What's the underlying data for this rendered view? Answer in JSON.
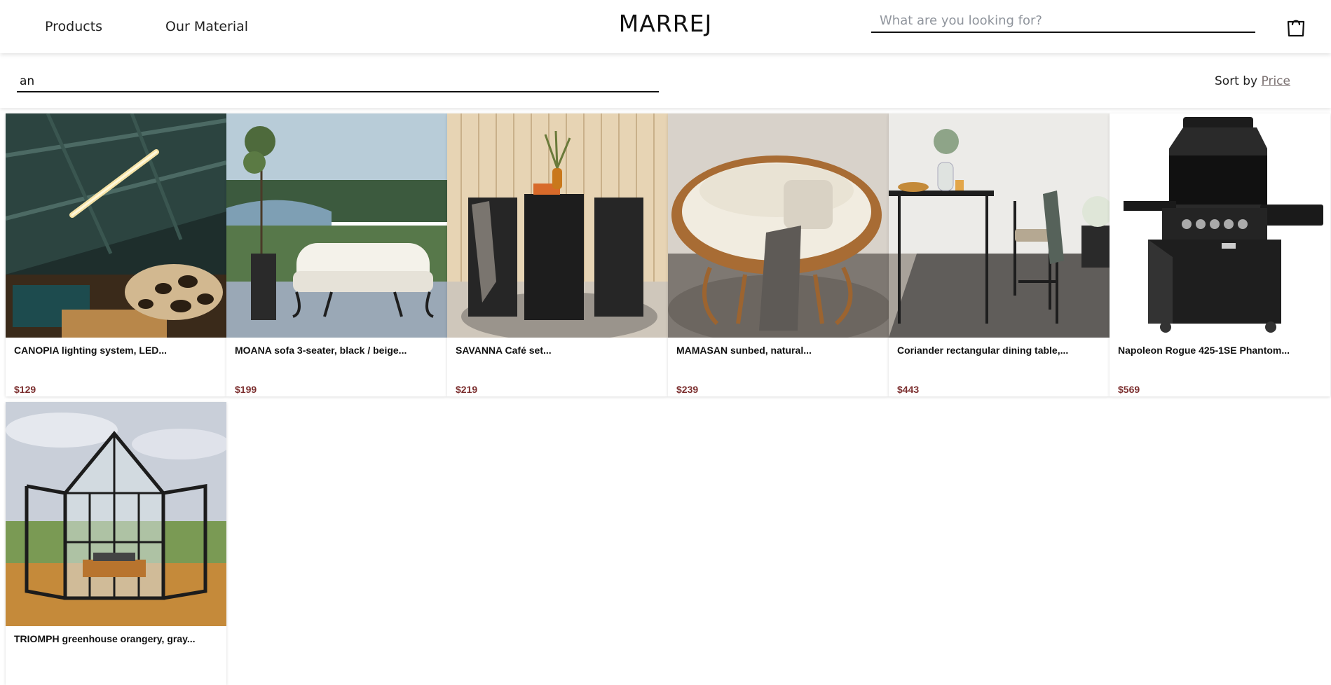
{
  "header": {
    "nav": [
      "Products",
      "Our Material"
    ],
    "logo": "MARREJ",
    "search_placeholder": "What are you looking for?",
    "cart_icon": "shopping-bag-icon"
  },
  "filter": {
    "query": "an",
    "sort_prefix": "Sort by",
    "sort_value": "Price"
  },
  "colors": {
    "price": "#7b2e2e",
    "sort_link": "#7a7070"
  },
  "products": [
    {
      "title": "CANOPIA lighting system, LED...",
      "price": "$129"
    },
    {
      "title": "MOANA sofa 3-seater, black / beige...",
      "price": "$199"
    },
    {
      "title": "SAVANNA Café set...",
      "price": "$219"
    },
    {
      "title": "MAMASAN sunbed, natural...",
      "price": "$239"
    },
    {
      "title": "Coriander rectangular dining table,...",
      "price": "$443"
    },
    {
      "title": "Napoleon Rogue 425-1SE Phantom...",
      "price": "$569"
    },
    {
      "title": "TRIOMPH greenhouse orangery, gray...",
      "price": ""
    }
  ]
}
